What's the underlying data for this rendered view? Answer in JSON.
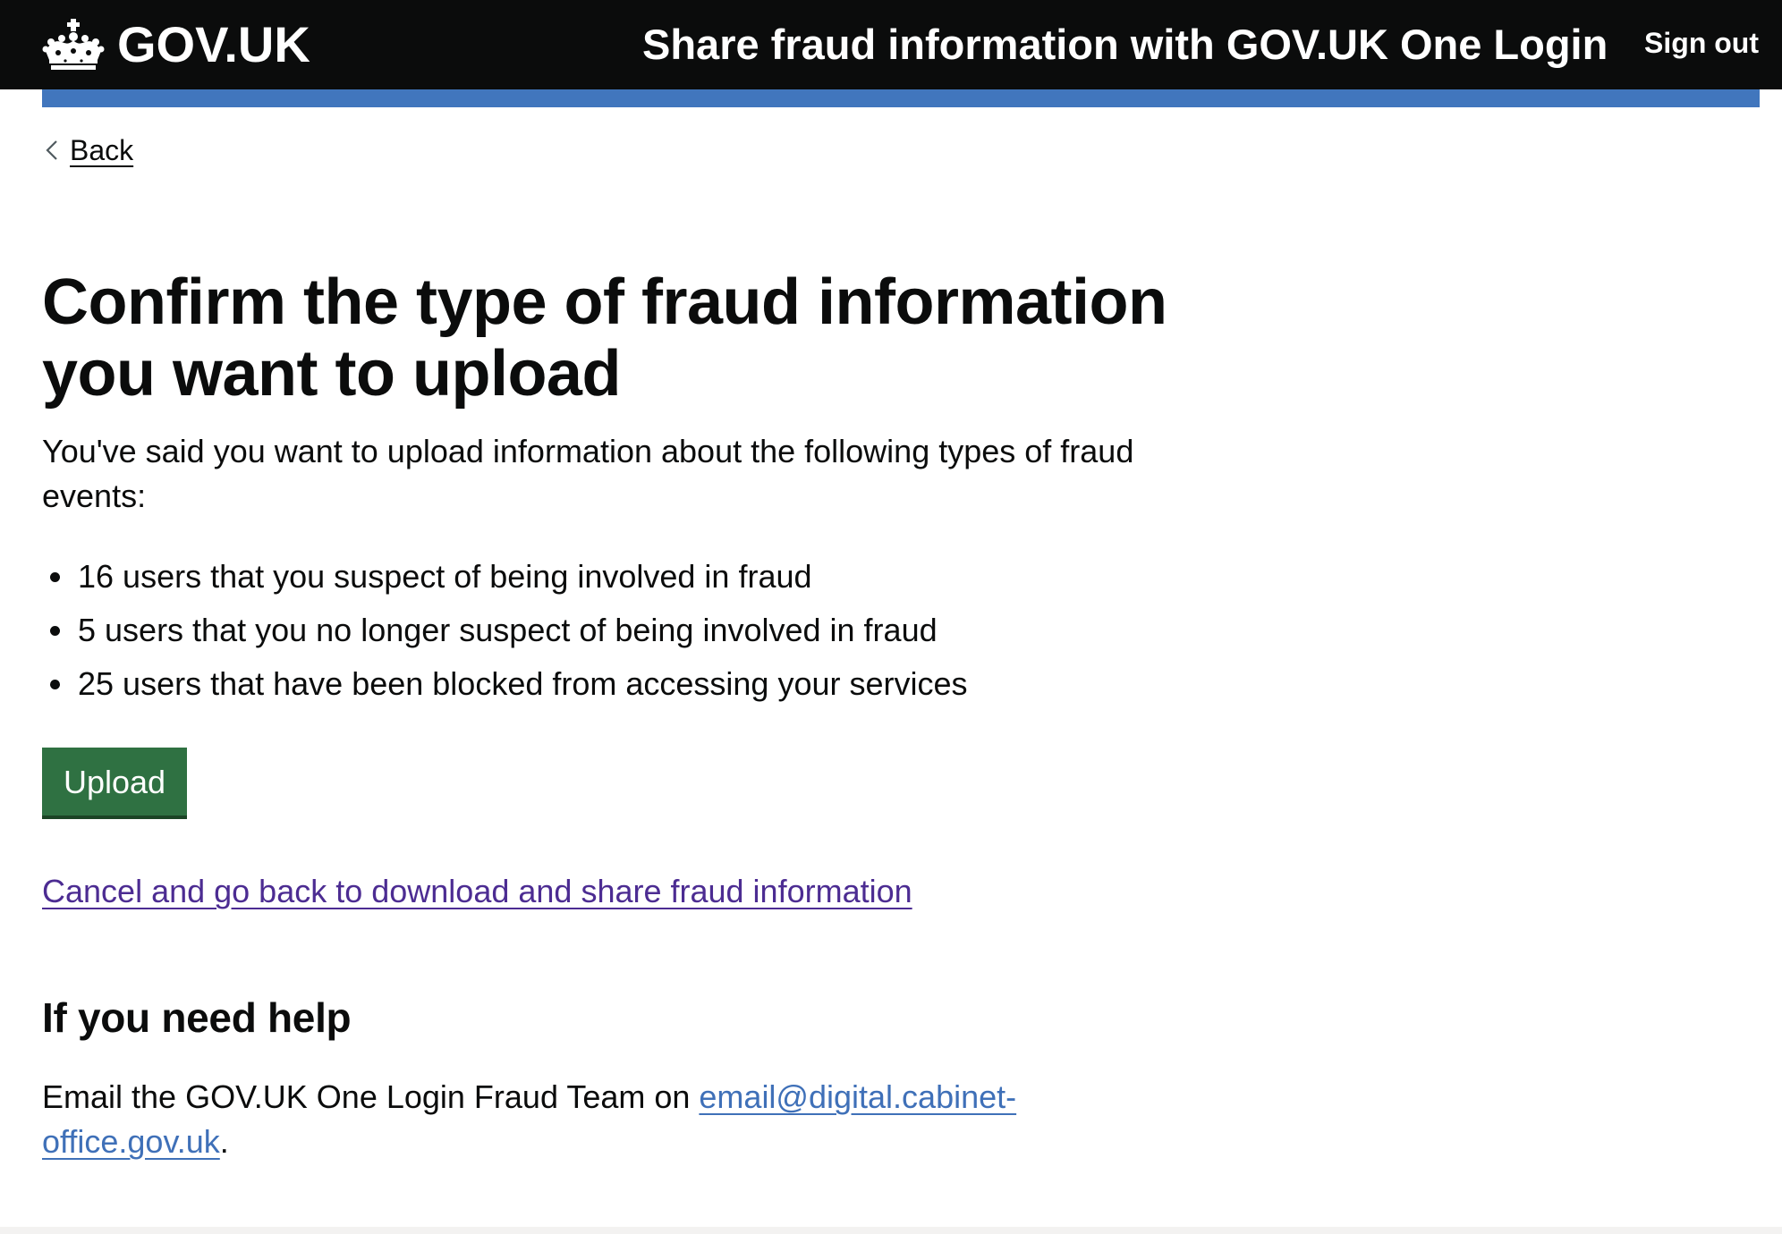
{
  "header": {
    "logo_text": "GOV.UK",
    "service_name": "Share fraud information with GOV.UK One Login",
    "sign_out_label": "Sign out",
    "background_color": "#0b0c0c",
    "accent_bar_color": "#4176bd",
    "logo_icon": "crown-icon"
  },
  "back_link": {
    "label": "Back",
    "icon": "chevron-left-icon"
  },
  "main": {
    "title": "Confirm the type of fraud information you want to upload",
    "intro": "You've said you want to upload information about the following types of fraud events:",
    "items": [
      {
        "text": "16 users that you suspect of being involved in fraud"
      },
      {
        "text": "5 users that you no longer suspect of being involved in fraud"
      },
      {
        "text": "25 users that have been blocked from accessing your services"
      }
    ],
    "upload_button_label": "Upload",
    "upload_button_color": "#2f7142",
    "cancel_link_label": "Cancel and go back to download and share fraud information",
    "cancel_link_color": "#4c2c92"
  },
  "help": {
    "heading": "If you need help",
    "text_before": "Email the GOV.UK One Login Fraud Team on ",
    "email": "email@digital.cabinet-office.gov.uk",
    "text_after": ".",
    "link_color": "#3f70b8"
  }
}
